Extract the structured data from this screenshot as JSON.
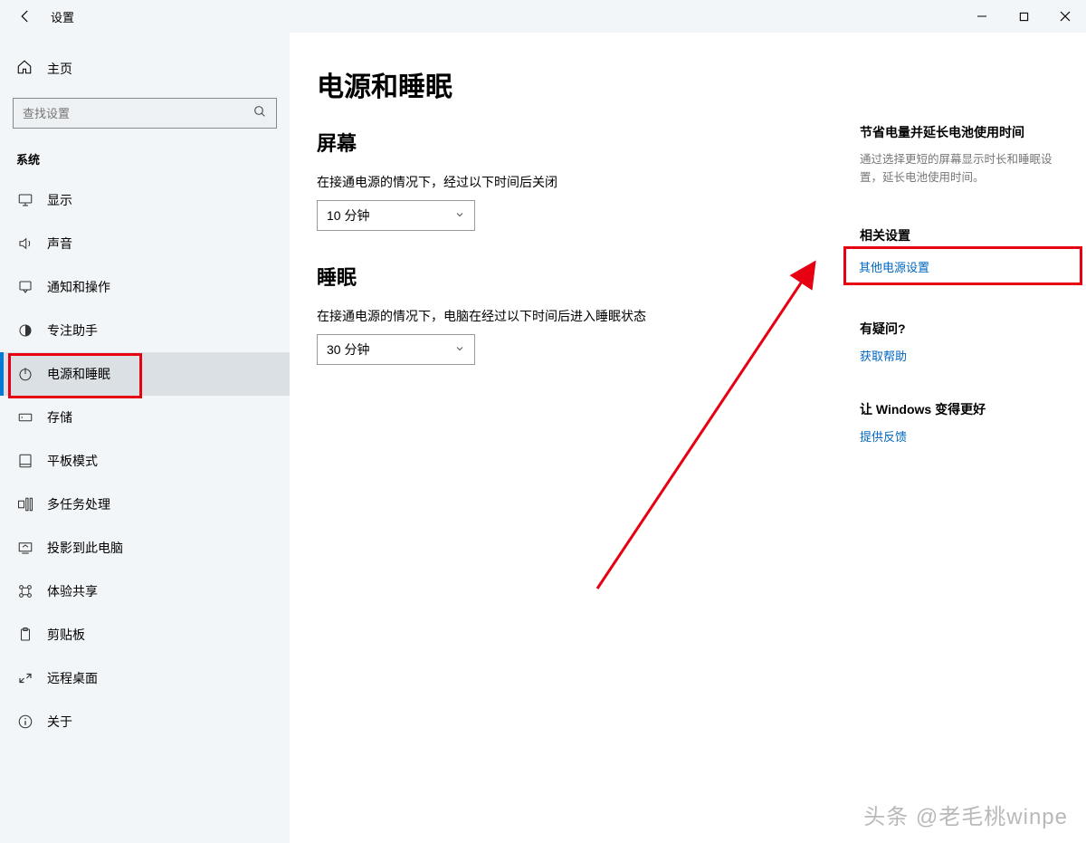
{
  "titlebar": {
    "title": "设置"
  },
  "sidebar": {
    "home": "主页",
    "search_placeholder": "查找设置",
    "section": "系统",
    "items": [
      {
        "icon": "display",
        "label": "显示",
        "selected": false
      },
      {
        "icon": "sound",
        "label": "声音",
        "selected": false
      },
      {
        "icon": "notify",
        "label": "通知和操作",
        "selected": false
      },
      {
        "icon": "focus",
        "label": "专注助手",
        "selected": false
      },
      {
        "icon": "power",
        "label": "电源和睡眠",
        "selected": true
      },
      {
        "icon": "storage",
        "label": "存储",
        "selected": false
      },
      {
        "icon": "tablet",
        "label": "平板模式",
        "selected": false
      },
      {
        "icon": "multi",
        "label": "多任务处理",
        "selected": false
      },
      {
        "icon": "project",
        "label": "投影到此电脑",
        "selected": false
      },
      {
        "icon": "share",
        "label": "体验共享",
        "selected": false
      },
      {
        "icon": "clip",
        "label": "剪贴板",
        "selected": false
      },
      {
        "icon": "remote",
        "label": "远程桌面",
        "selected": false
      },
      {
        "icon": "about",
        "label": "关于",
        "selected": false
      }
    ]
  },
  "content": {
    "page_title": "电源和睡眠",
    "screen": {
      "heading": "屏幕",
      "label": "在接通电源的情况下，经过以下时间后关闭",
      "value": "10 分钟"
    },
    "sleep": {
      "heading": "睡眠",
      "label": "在接通电源的情况下，电脑在经过以下时间后进入睡眠状态",
      "value": "30 分钟"
    }
  },
  "aside": {
    "saving_title": "节省电量并延长电池使用时间",
    "saving_desc": "通过选择更短的屏幕显示时长和睡眠设置，延长电池使用时间。",
    "related_title": "相关设置",
    "related_link": "其他电源设置",
    "question_title": "有疑问?",
    "question_link": "获取帮助",
    "better_title": "让 Windows 变得更好",
    "better_link": "提供反馈"
  },
  "watermark": "头条 @老毛桃winpe"
}
